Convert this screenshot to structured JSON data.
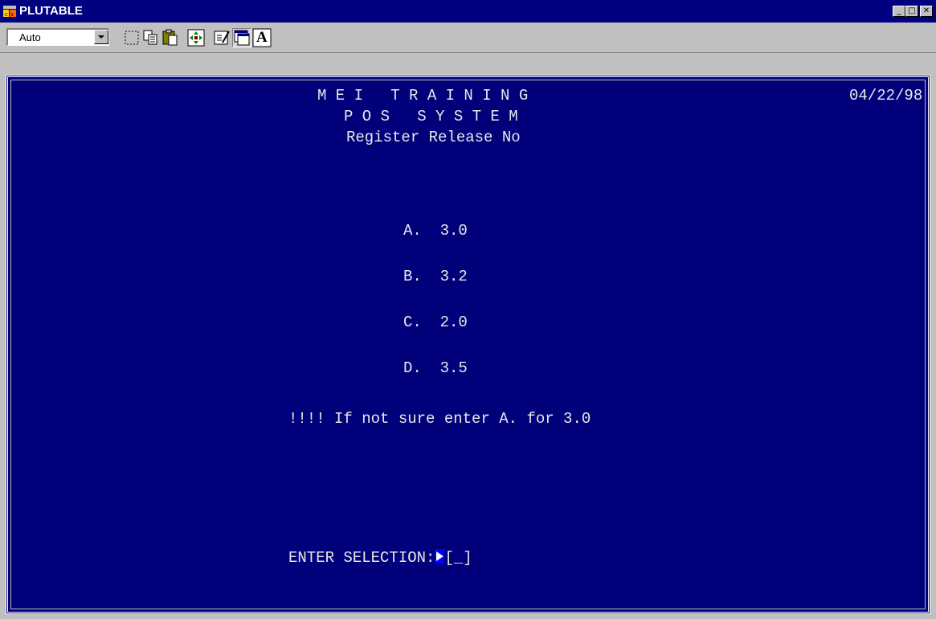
{
  "window": {
    "title": "PLUTABLE",
    "controls": {
      "minimize": "_",
      "maximize": "□",
      "close": "✕"
    }
  },
  "toolbar": {
    "font_size_value": "Auto",
    "buttons": [
      "select-icon",
      "copy-icon",
      "paste-icon",
      "fullscreen-icon",
      "properties-icon",
      "background-icon",
      "font-icon"
    ],
    "font_button_label": "A"
  },
  "terminal": {
    "colors": {
      "background": "#00007b",
      "text": "#e8e8e8",
      "cursor": "#0000ff"
    },
    "title_line1": "M E I   T R A I N I N G",
    "date": "04/22/98",
    "title_line2": "P O S   S Y S T E M",
    "title_line3": "Register Release No",
    "options": [
      {
        "key": "A.",
        "value": "3.0"
      },
      {
        "key": "B.",
        "value": "3.2"
      },
      {
        "key": "C.",
        "value": "2.0"
      },
      {
        "key": "D.",
        "value": "3.5"
      }
    ],
    "hint": "!!!! If not sure enter A. for 3.0",
    "prompt_label": "ENTER SELECTION:",
    "input_value": "[_]"
  }
}
